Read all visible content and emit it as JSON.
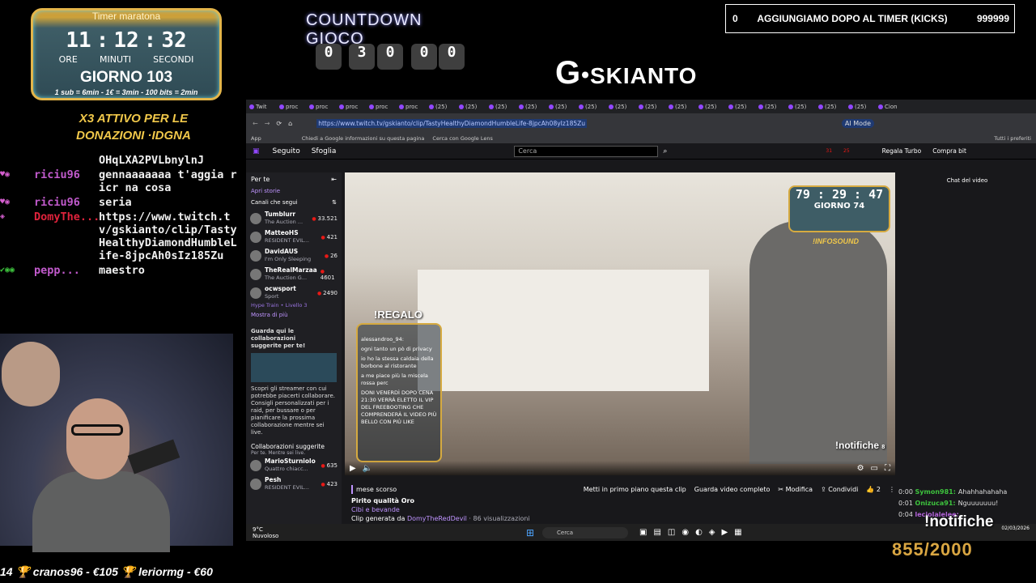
{
  "timer": {
    "title": "Timer maratona",
    "h": "11",
    "m": "12",
    "s": "32",
    "u_h": "ORE",
    "u_m": "MINUTI",
    "u_s": "SECONDI",
    "day": "GIORNO 103",
    "rule": "1 sub = 6min - 1€ = 3min - 100 bits = 2min"
  },
  "promo_x3": "X3 ATTIVO PER LE DONAZIONI ·IDGNA",
  "chat_overlay": [
    {
      "user": "",
      "msg": "OHqLXA2PVLbnylnJ"
    },
    {
      "user": "riciu96",
      "msg": "gennaaaaaaa t'aggia ricr na cosa"
    },
    {
      "user": "riciu96",
      "msg": "seria"
    },
    {
      "user": "DomyThe...",
      "msg": "https://www.twitch.tv/gskianto/clip/TastyHealthyDiamondHumbleLife-8jpcAh0sIz185Zu"
    },
    {
      "user": "pepp...",
      "msg": "maestro"
    }
  ],
  "countdown": {
    "title": "COUNTDOWN GIOCO",
    "digits": [
      "0",
      "3",
      "0",
      "0",
      "0"
    ]
  },
  "logo": {
    "g": "G",
    "dot": "•",
    "name": "SKIANTO"
  },
  "kick_bar": {
    "left": "0",
    "center": "AGGIUNGIAMO DOPO AL TIMER (KICKS)",
    "right": "999999"
  },
  "browser": {
    "tabs": [
      "Twit",
      "proc",
      "proc",
      "proc",
      "proc",
      "proc",
      "(25)",
      "(25)",
      "(25)",
      "(25)",
      "(25)",
      "(25)",
      "(25)",
      "(25)",
      "(25)",
      "(25)",
      "(25)",
      "(25)",
      "(25)",
      "(25)",
      "(25)",
      "Cion"
    ],
    "url": "https://www.twitch.tv/gskianto/clip/TastyHealthyDiamondHumbleLife-8jpcAh08yIz185Zu",
    "ai_mode": "AI Mode",
    "bookmarks": [
      "App",
      "Chiedi a Google informazioni su questa pagina",
      "Cerca con Google Lens",
      "Tutti i preferiti"
    ],
    "twitch_nav": {
      "following": "Seguito",
      "browse": "Sfoglia",
      "search": "Cerca",
      "badge1": "31",
      "badge2": "25",
      "gift": "Regala Turbo",
      "bits": "Compra bit"
    },
    "sidebar": {
      "title": "Per te",
      "stories": "Apri storie",
      "followed": "Canali che segui",
      "channels": [
        {
          "name": "Tumblurr",
          "game": "The Auction ...",
          "viewers": "33.521"
        },
        {
          "name": "MatteoHS",
          "game": "RESIDENT EVIL...",
          "viewers": "421"
        },
        {
          "name": "DavidAUS",
          "game": "I'm Only Sleeping",
          "viewers": "26"
        },
        {
          "name": "TheRealMarzaa",
          "game": "The Auction G...",
          "viewers": "4601"
        },
        {
          "name": "ocwsport",
          "game": "Sport",
          "viewers": "2490"
        }
      ],
      "hype": "Hype Train • Livello 3",
      "more": "Mostra di più",
      "promo_title": "Guarda qui le collaborazioni suggerite per te!",
      "promo_text": "Scopri gli streamer con cui potrebbe piacerti collaborare. Consigli personalizzati per i raid, per bussare o per pianificare la prossima collaborazione mentre sei live.",
      "collab_title": "Collaborazioni suggerite",
      "collab_sub": "Per te. Mentre sei live.",
      "collab": [
        {
          "name": "MarioSturniolo",
          "game": "Quattro chiacc...",
          "viewers": "635"
        },
        {
          "name": "Pesh",
          "game": "RESIDENT EVIL...",
          "viewers": "423"
        }
      ]
    },
    "video": {
      "timer_day": "GIORNO 74",
      "timer": "79 : 29 : 47",
      "infosound": "!INFOSOUND",
      "regalo": "!REGALO",
      "notif": "!notifiche",
      "notif_count": "8",
      "mini_chat": [
        "alessandroo_94:",
        "ogni tanto un pò di privacy",
        "io ho la stessa caldaia della borbone al ristorante",
        "a me piace più la miscela rossa perc",
        "DONI VENERDÌ DOPO CENA 21:30 VERRÀ ELETTO IL VIP DEL FREEBOOTING CHE COMPRENDERÀ IL VIDEO PIÙ BELLO CON PIÙ LIKE"
      ]
    },
    "clip": {
      "time": "mese scorso",
      "title": "Pirito qualità Oro",
      "category": "Cibi e bevande",
      "by_prefix": "Clip generata da ",
      "by": "DomyTheRedDevil",
      "views": " · 86 visualizzazioni",
      "btn_pin": "Metti in primo piano questa clip",
      "btn_full": "Guarda video completo",
      "btn_edit": "Modifica",
      "btn_share": "Condividi",
      "likes": "2"
    },
    "video_chat_title": "Chat del video",
    "taskbar": {
      "weather_temp": "9°C",
      "weather": "Nuvoloso",
      "search": "Cerca",
      "date": "02/03/2026"
    }
  },
  "video_chat": [
    {
      "t": "0:00",
      "user": "Symon981:",
      "msg": "Ahahhahahaha",
      "color": "#3dc23d"
    },
    {
      "t": "0:01",
      "user": "Onizuca91:",
      "msg": "Nguuuuuuu!",
      "color": "#3dc23d"
    },
    {
      "t": "0:04",
      "user": "leciolalelee:",
      "msg": "",
      "color": "#b061d6"
    }
  ],
  "notifiche_big": "!notifiche",
  "sub_counter": "855/2000",
  "ticker": "14   🏆 cranos96 - €105     🏆 leriormg - €60"
}
